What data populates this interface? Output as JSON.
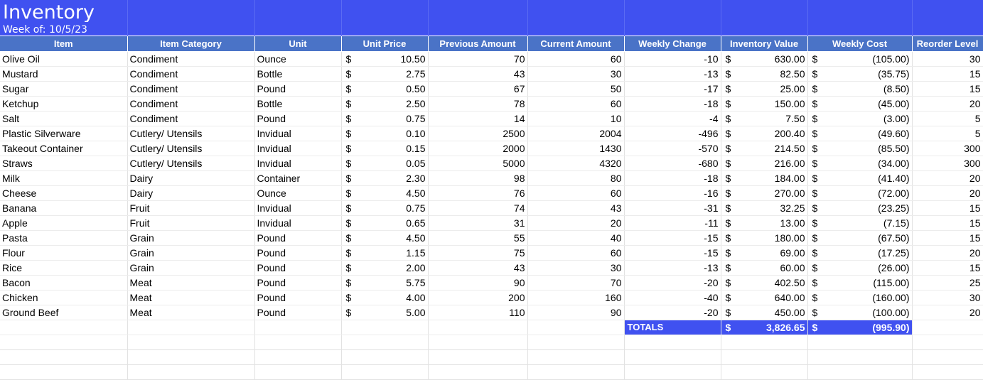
{
  "sheet": {
    "title": "Inventory",
    "subtitle": "Week of: 10/5/23",
    "currency_symbol": "$",
    "colors": {
      "title_bg": "#4051f0",
      "header_bg": "#4a73c7",
      "totals_bg": "#4051f0"
    },
    "headers": [
      "Item",
      "Item Category",
      "Unit",
      "Unit Price",
      "Previous Amount",
      "Current Amount",
      "Weekly Change",
      "Inventory Value",
      "Weekly Cost",
      "Reorder Level"
    ],
    "rows": [
      {
        "item": "Olive Oil",
        "category": "Condiment",
        "unit": "Ounce",
        "unit_price": "10.50",
        "previous": "70",
        "current": "60",
        "change": "-10",
        "value": "630.00",
        "cost": "(105.00)",
        "reorder": "30"
      },
      {
        "item": "Mustard",
        "category": "Condiment",
        "unit": "Bottle",
        "unit_price": "2.75",
        "previous": "43",
        "current": "30",
        "change": "-13",
        "value": "82.50",
        "cost": "(35.75)",
        "reorder": "15"
      },
      {
        "item": "Sugar",
        "category": "Condiment",
        "unit": "Pound",
        "unit_price": "0.50",
        "previous": "67",
        "current": "50",
        "change": "-17",
        "value": "25.00",
        "cost": "(8.50)",
        "reorder": "15"
      },
      {
        "item": "Ketchup",
        "category": "Condiment",
        "unit": "Bottle",
        "unit_price": "2.50",
        "previous": "78",
        "current": "60",
        "change": "-18",
        "value": "150.00",
        "cost": "(45.00)",
        "reorder": "20"
      },
      {
        "item": "Salt",
        "category": "Condiment",
        "unit": "Pound",
        "unit_price": "0.75",
        "previous": "14",
        "current": "10",
        "change": "-4",
        "value": "7.50",
        "cost": "(3.00)",
        "reorder": "5"
      },
      {
        "item": "Plastic Silverware",
        "category": "Cutlery/ Utensils",
        "unit": "Invidual",
        "unit_price": "0.10",
        "previous": "2500",
        "current": "2004",
        "change": "-496",
        "value": "200.40",
        "cost": "(49.60)",
        "reorder": "5"
      },
      {
        "item": "Takeout Container",
        "category": "Cutlery/ Utensils",
        "unit": "Invidual",
        "unit_price": "0.15",
        "previous": "2000",
        "current": "1430",
        "change": "-570",
        "value": "214.50",
        "cost": "(85.50)",
        "reorder": "300"
      },
      {
        "item": "Straws",
        "category": "Cutlery/ Utensils",
        "unit": "Invidual",
        "unit_price": "0.05",
        "previous": "5000",
        "current": "4320",
        "change": "-680",
        "value": "216.00",
        "cost": "(34.00)",
        "reorder": "300"
      },
      {
        "item": "Milk",
        "category": "Dairy",
        "unit": "Container",
        "unit_price": "2.30",
        "previous": "98",
        "current": "80",
        "change": "-18",
        "value": "184.00",
        "cost": "(41.40)",
        "reorder": "20"
      },
      {
        "item": "Cheese",
        "category": "Dairy",
        "unit": "Ounce",
        "unit_price": "4.50",
        "previous": "76",
        "current": "60",
        "change": "-16",
        "value": "270.00",
        "cost": "(72.00)",
        "reorder": "20"
      },
      {
        "item": "Banana",
        "category": "Fruit",
        "unit": "Invidual",
        "unit_price": "0.75",
        "previous": "74",
        "current": "43",
        "change": "-31",
        "value": "32.25",
        "cost": "(23.25)",
        "reorder": "15"
      },
      {
        "item": "Apple",
        "category": "Fruit",
        "unit": "Invidual",
        "unit_price": "0.65",
        "previous": "31",
        "current": "20",
        "change": "-11",
        "value": "13.00",
        "cost": "(7.15)",
        "reorder": "15"
      },
      {
        "item": "Pasta",
        "category": "Grain",
        "unit": "Pound",
        "unit_price": "4.50",
        "previous": "55",
        "current": "40",
        "change": "-15",
        "value": "180.00",
        "cost": "(67.50)",
        "reorder": "15"
      },
      {
        "item": "Flour",
        "category": "Grain",
        "unit": "Pound",
        "unit_price": "1.15",
        "previous": "75",
        "current": "60",
        "change": "-15",
        "value": "69.00",
        "cost": "(17.25)",
        "reorder": "20"
      },
      {
        "item": "Rice",
        "category": "Grain",
        "unit": "Pound",
        "unit_price": "2.00",
        "previous": "43",
        "current": "30",
        "change": "-13",
        "value": "60.00",
        "cost": "(26.00)",
        "reorder": "15"
      },
      {
        "item": "Bacon",
        "category": "Meat",
        "unit": "Pound",
        "unit_price": "5.75",
        "previous": "90",
        "current": "70",
        "change": "-20",
        "value": "402.50",
        "cost": "(115.00)",
        "reorder": "25"
      },
      {
        "item": "Chicken",
        "category": "Meat",
        "unit": "Pound",
        "unit_price": "4.00",
        "previous": "200",
        "current": "160",
        "change": "-40",
        "value": "640.00",
        "cost": "(160.00)",
        "reorder": "30"
      },
      {
        "item": "Ground Beef",
        "category": "Meat",
        "unit": "Pound",
        "unit_price": "5.00",
        "previous": "110",
        "current": "90",
        "change": "-20",
        "value": "450.00",
        "cost": "(100.00)",
        "reorder": "20"
      }
    ],
    "totals": {
      "label": "TOTALS",
      "inventory_value": "3,826.65",
      "weekly_cost": "(995.90)"
    }
  }
}
